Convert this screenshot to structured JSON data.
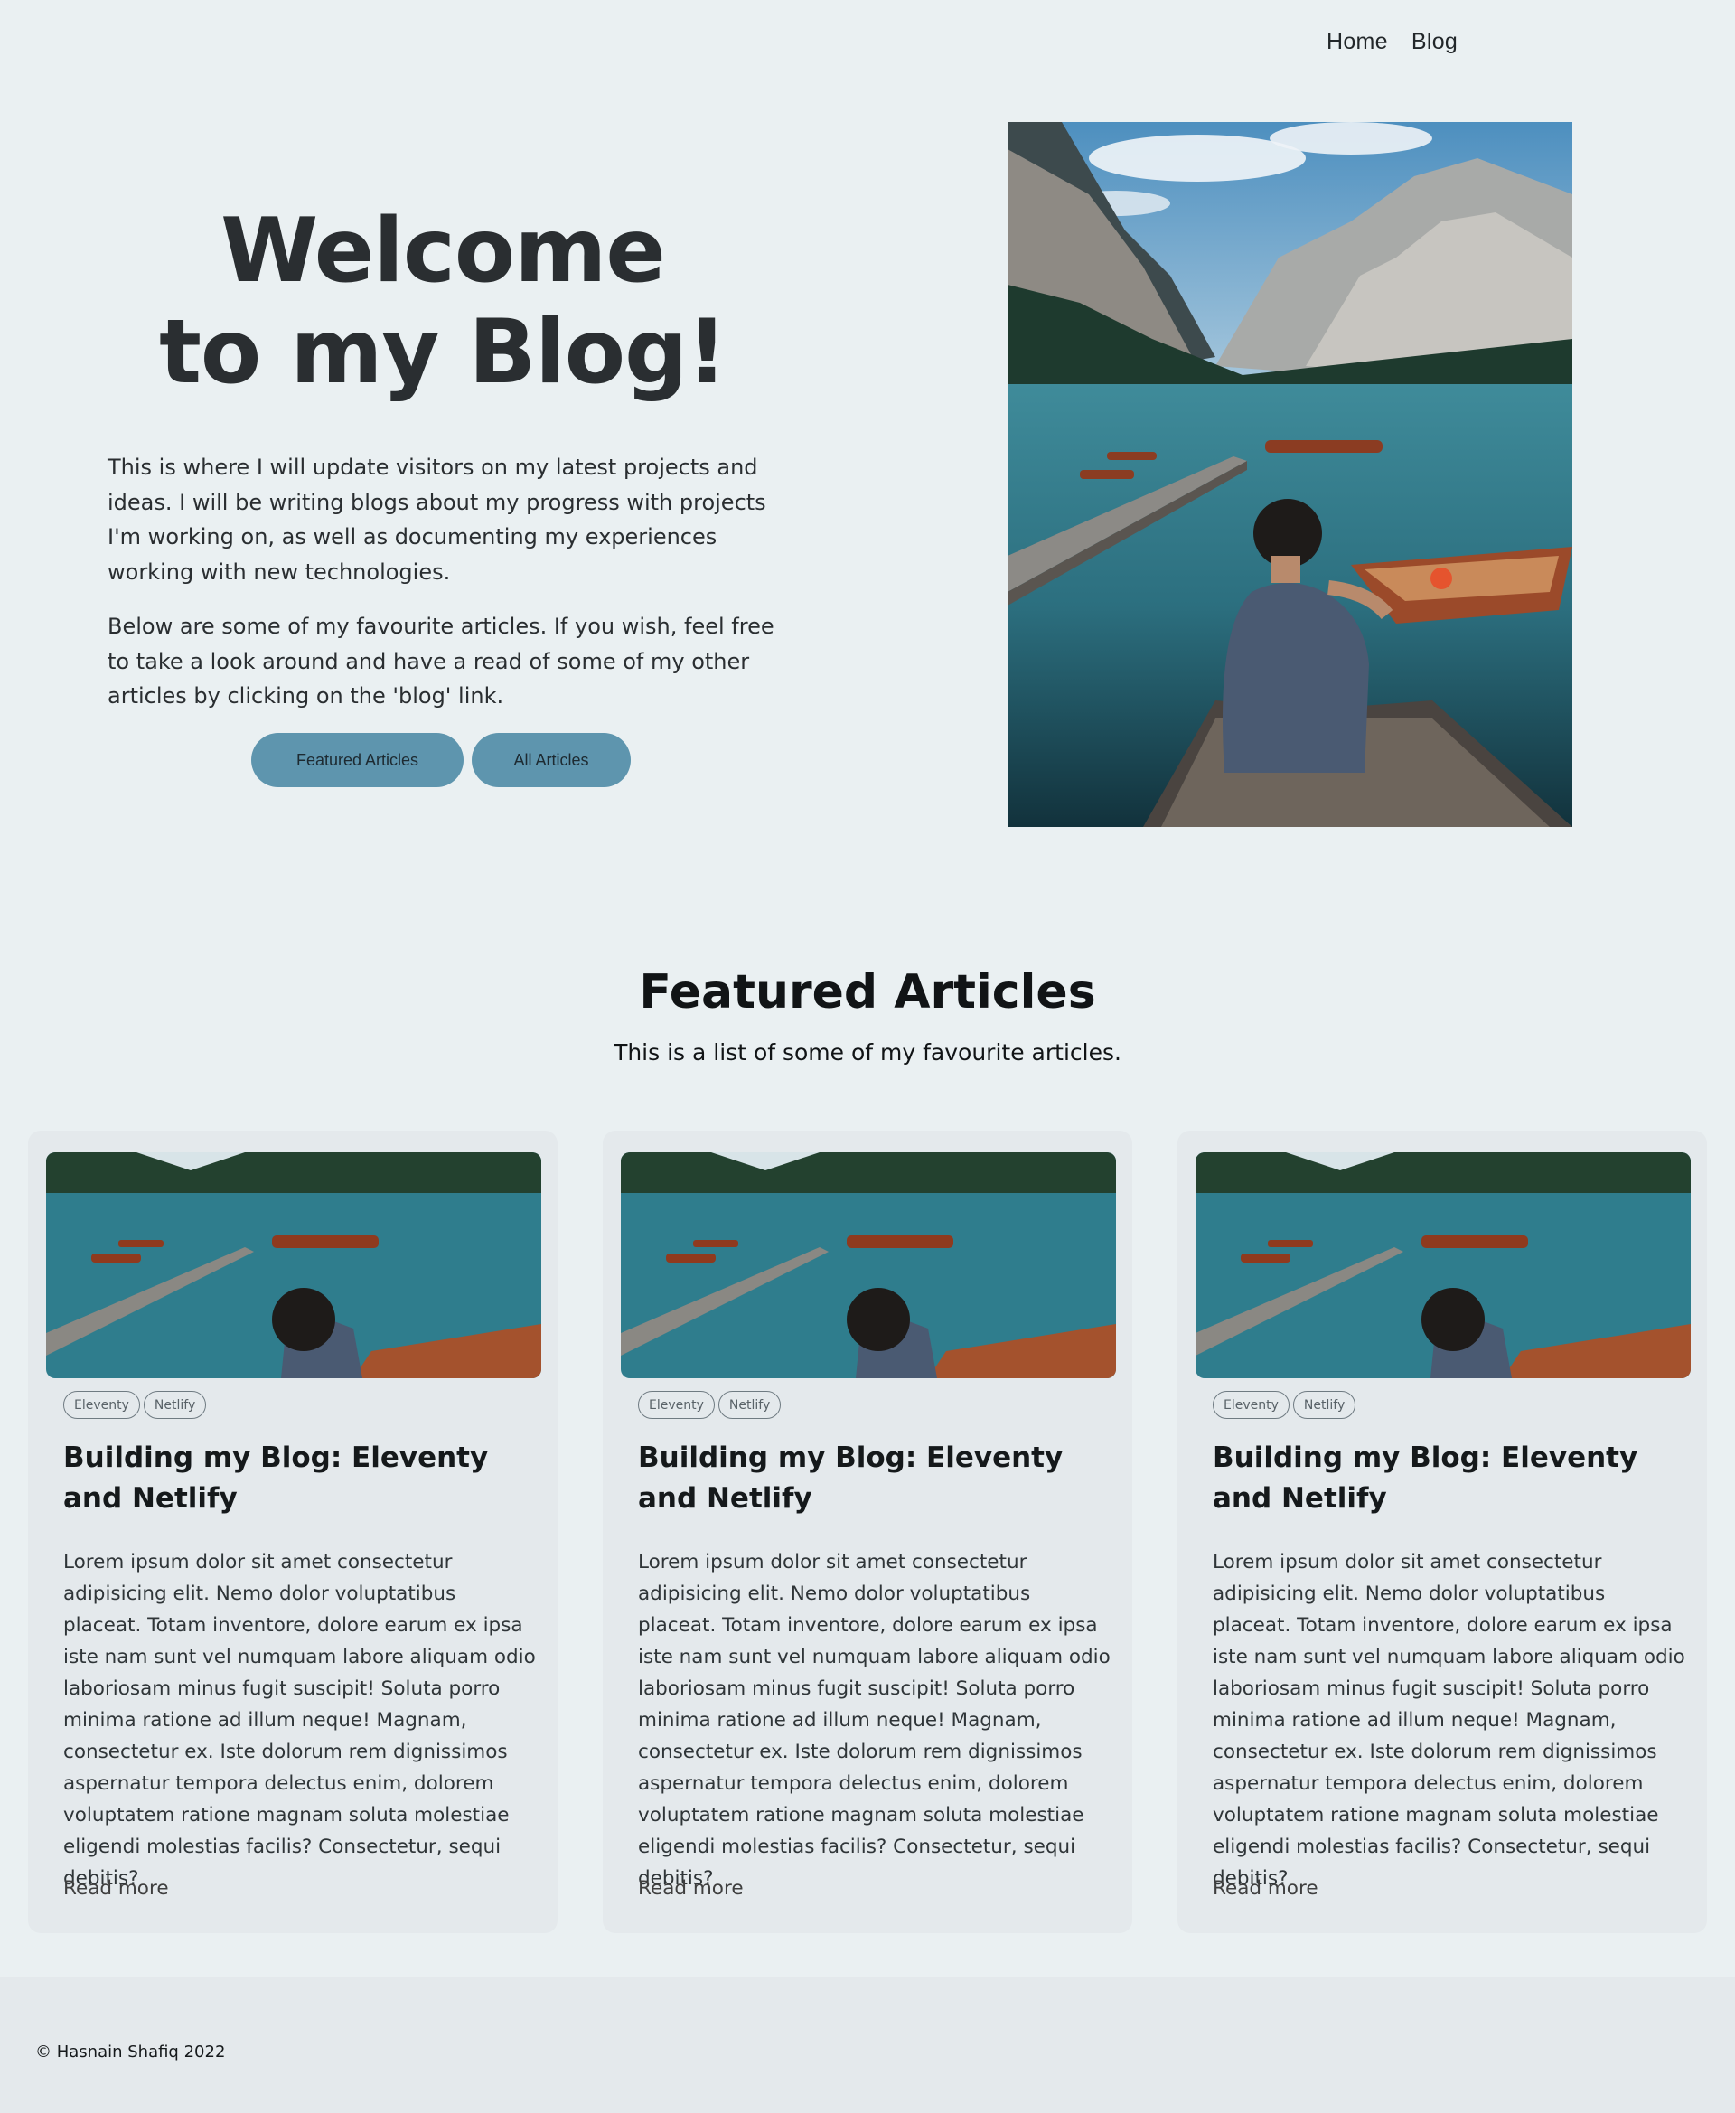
{
  "nav": {
    "home": "Home",
    "blog": "Blog"
  },
  "hero": {
    "title_line1": "Welcome",
    "title_line2": "to my Blog!",
    "paragraph1": "This is where I will update visitors on my latest projects and ideas. I will be writing blogs about my progress with projects I'm working on, as well as documenting my experiences working with new technologies.",
    "paragraph2": "Below are some of my favourite articles. If you wish, feel free to take a look around and have a read of some of my other articles by clicking on the 'blog' link.",
    "button_featured": "Featured Articles",
    "button_all": "All Articles"
  },
  "featured": {
    "title": "Featured Articles",
    "subtitle": "This is a list of some of my favourite articles.",
    "cards": [
      {
        "tags": [
          "Eleventy",
          "Netlify"
        ],
        "title": "Building my Blog: Eleventy and Netlify",
        "body": "Lorem ipsum dolor sit amet consectetur adipisicing elit. Nemo dolor voluptatibus placeat. Totam inventore, dolore earum ex ipsa iste nam sunt vel numquam labore aliquam odio laboriosam minus fugit suscipit! Soluta porro minima ratione ad illum neque! Magnam, consectetur ex. Iste dolorum rem dignissimos aspernatur tempora delectus enim, dolorem voluptatem ratione magnam soluta molestiae eligendi molestias facilis? Consectetur, sequi debitis?",
        "read_more": "Read more"
      },
      {
        "tags": [
          "Eleventy",
          "Netlify"
        ],
        "title": "Building my Blog: Eleventy and Netlify",
        "body": "Lorem ipsum dolor sit amet consectetur adipisicing elit. Nemo dolor voluptatibus placeat. Totam inventore, dolore earum ex ipsa iste nam sunt vel numquam labore aliquam odio laboriosam minus fugit suscipit! Soluta porro minima ratione ad illum neque! Magnam, consectetur ex. Iste dolorum rem dignissimos aspernatur tempora delectus enim, dolorem voluptatem ratione magnam soluta molestiae eligendi molestias facilis? Consectetur, sequi debitis?",
        "read_more": "Read more"
      },
      {
        "tags": [
          "Eleventy",
          "Netlify"
        ],
        "title": "Building my Blog: Eleventy and Netlify",
        "body": "Lorem ipsum dolor sit amet consectetur adipisicing elit. Nemo dolor voluptatibus placeat. Totam inventore, dolore earum ex ipsa iste nam sunt vel numquam labore aliquam odio laboriosam minus fugit suscipit! Soluta porro minima ratione ad illum neque! Magnam, consectetur ex. Iste dolorum rem dignissimos aspernatur tempora delectus enim, dolorem voluptatem ratione magnam soluta molestiae eligendi molestias facilis? Consectetur, sequi debitis?",
        "read_more": "Read more"
      }
    ]
  },
  "footer": {
    "copyright": "© Hasnain Shafiq 2022"
  },
  "colors": {
    "background": "#eaf0f2",
    "button": "#5e95ae",
    "card": "#e4e9ec",
    "footer": "#e4e9ec"
  }
}
